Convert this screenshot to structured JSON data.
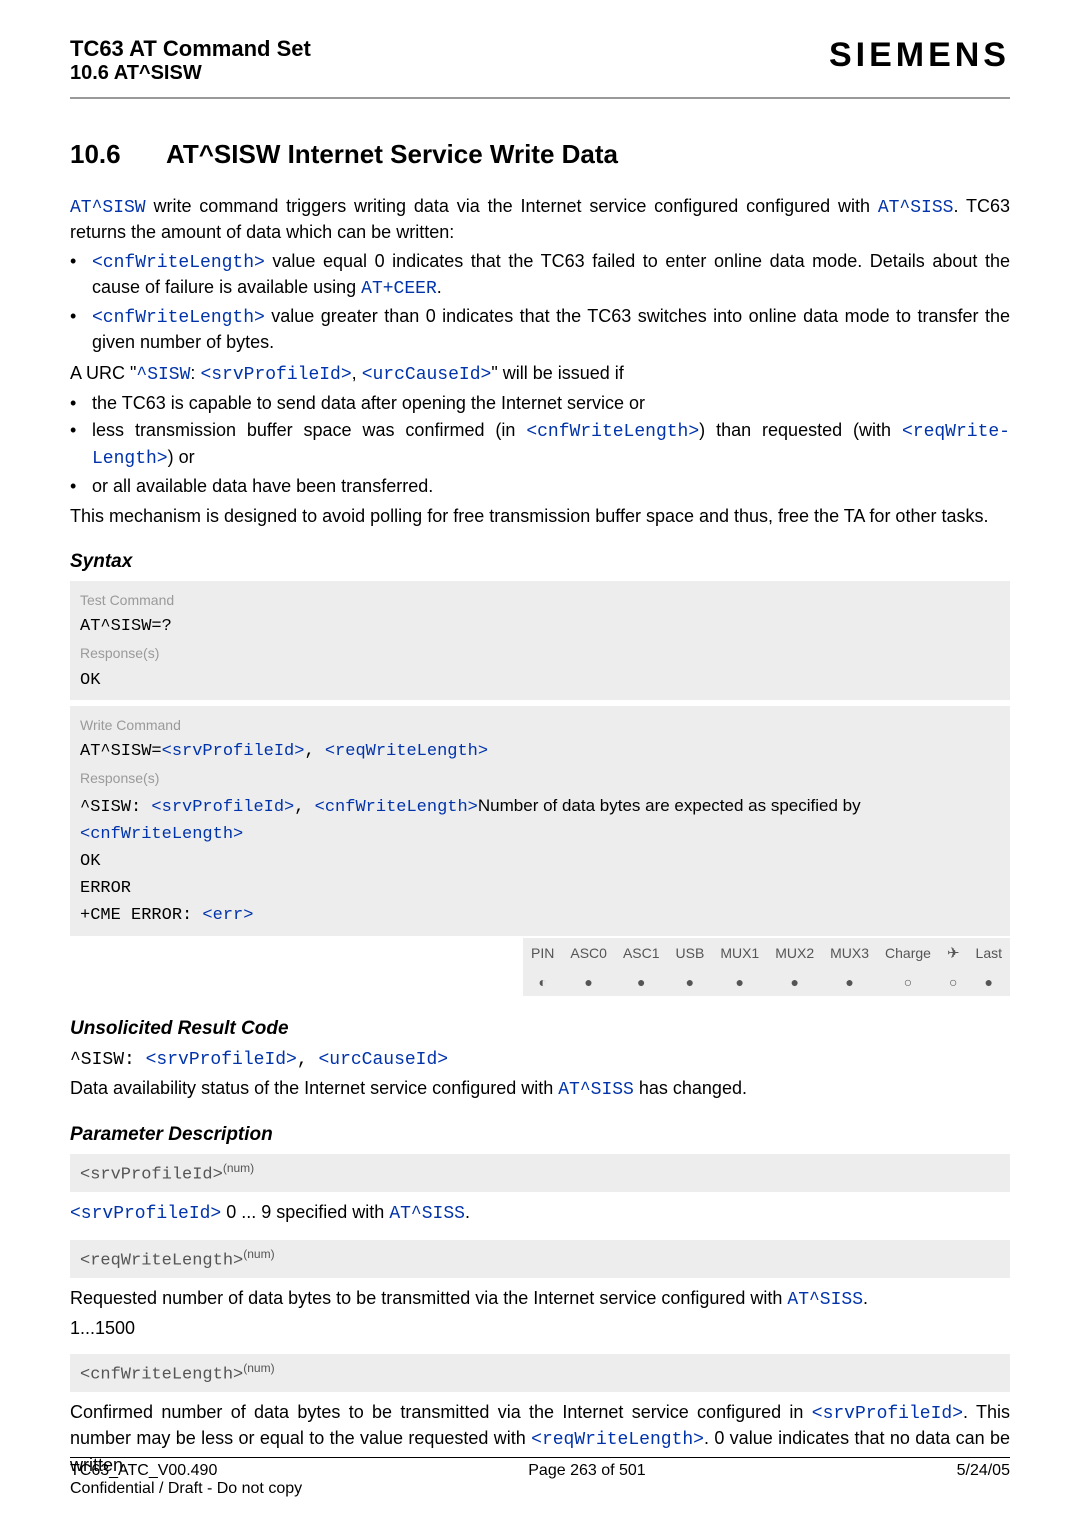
{
  "header": {
    "doc_title": "TC63 AT Command Set",
    "section_ref": "10.6 AT^SISW",
    "brand": "SIEMENS"
  },
  "section": {
    "number": "10.6",
    "title": "AT^SISW   Internet Service Write Data"
  },
  "intro": {
    "p1_a": "AT^SISW",
    "p1_b": " write command triggers writing data via the Internet service configured configured with ",
    "p1_c": "AT^SISS",
    "p1_d": ". TC63 returns the amount of data which can be written:",
    "b1_a": "<cnfWriteLength>",
    "b1_b": " value equal 0 indicates that the TC63 failed to enter online data mode. Details about the cause of failure is available using ",
    "b1_c": "AT+CEER",
    "b1_d": ".",
    "b2_a": "<cnfWriteLength>",
    "b2_b": " value greater than 0 indicates that the TC63 switches into online data mode to transfer the given number of bytes.",
    "p2_a": "A URC \"",
    "p2_b": "^SISW",
    "p2_c": ": ",
    "p2_d": "<srvProfileId>",
    "p2_e": ", ",
    "p2_f": "<urcCauseId>",
    "p2_g": "\" will be issued if",
    "b3": "the TC63 is capable to send data after opening the Internet service or",
    "b4_a": "less transmission buffer space was confirmed (in ",
    "b4_b": "<cnfWriteLength>",
    "b4_c": ") than requested (with ",
    "b4_d": "<reqWrite-Length>",
    "b4_e": ") or",
    "b5": "or all available data have been transferred.",
    "p3": "This mechanism is designed to avoid polling for free transmission buffer space and thus, free the TA for other tasks."
  },
  "syntax": {
    "heading": "Syntax",
    "test_label": "Test Command",
    "test_cmd": "AT^SISW=?",
    "resp_label": "Response(s)",
    "resp_ok": "OK",
    "write_label": "Write Command",
    "write_cmd_a": "AT^SISW=",
    "write_cmd_b": "<srvProfileId>",
    "write_cmd_c": ", ",
    "write_cmd_d": "<reqWriteLength>",
    "resp2_a": "^SISW: ",
    "resp2_b": "<srvProfileId>",
    "resp2_c": ", ",
    "resp2_d": "<cnfWriteLength>",
    "resp2_e": "Number of data bytes are expected as specified by ",
    "resp2_f": "<cnfWriteLength>",
    "resp2_ok": "OK",
    "resp2_err": "ERROR",
    "resp2_cme_a": "+CME ERROR: ",
    "resp2_cme_b": "<err>"
  },
  "matrix": {
    "cols": [
      "PIN",
      "ASC0",
      "ASC1",
      "USB",
      "MUX1",
      "MUX2",
      "MUX3",
      "Charge",
      "✈",
      "Last"
    ],
    "pin": "◐",
    "f1": "●",
    "f2": "●",
    "f3": "●",
    "f4": "●",
    "f5": "●",
    "f6": "●",
    "o1": "○",
    "o2": "○",
    "last": "●"
  },
  "urc": {
    "heading": "Unsolicited Result Code",
    "line_a": "^SISW: ",
    "line_b": "<srvProfileId>",
    "line_c": ", ",
    "line_d": "<urcCauseId>",
    "desc_a": "Data availability status of the Internet service configured with ",
    "desc_b": "AT^SISS",
    "desc_c": " has changed."
  },
  "params": {
    "heading": "Parameter Description",
    "p1_code": "<srvProfileId>",
    "p1_sup": "(num)",
    "p1_desc_a": "<srvProfileId>",
    "p1_desc_b": " 0 ... 9 specified with ",
    "p1_desc_c": "AT^SISS",
    "p1_desc_d": ".",
    "p2_code": "<reqWriteLength>",
    "p2_sup": "(num)",
    "p2_desc_a": "Requested number of data bytes to be transmitted via the Internet service configured with ",
    "p2_desc_b": "AT^SISS",
    "p2_desc_c": ".",
    "p2_range": "1...1500",
    "p3_code": "<cnfWriteLength>",
    "p3_sup": "(num)",
    "p3_desc_a": "Confirmed number of data bytes to be transmitted via the Internet service configured in ",
    "p3_desc_b": "<srvProfileId>",
    "p3_desc_c": ". This number may be less or equal to the value requested with ",
    "p3_desc_d": "<reqWriteLength>",
    "p3_desc_e": ". 0 value indicates that no data can be written."
  },
  "footer": {
    "left": "TC63_ATC_V00.490",
    "center": "Page 263 of 501",
    "right": "5/24/05",
    "conf": "Confidential / Draft - Do not copy"
  }
}
